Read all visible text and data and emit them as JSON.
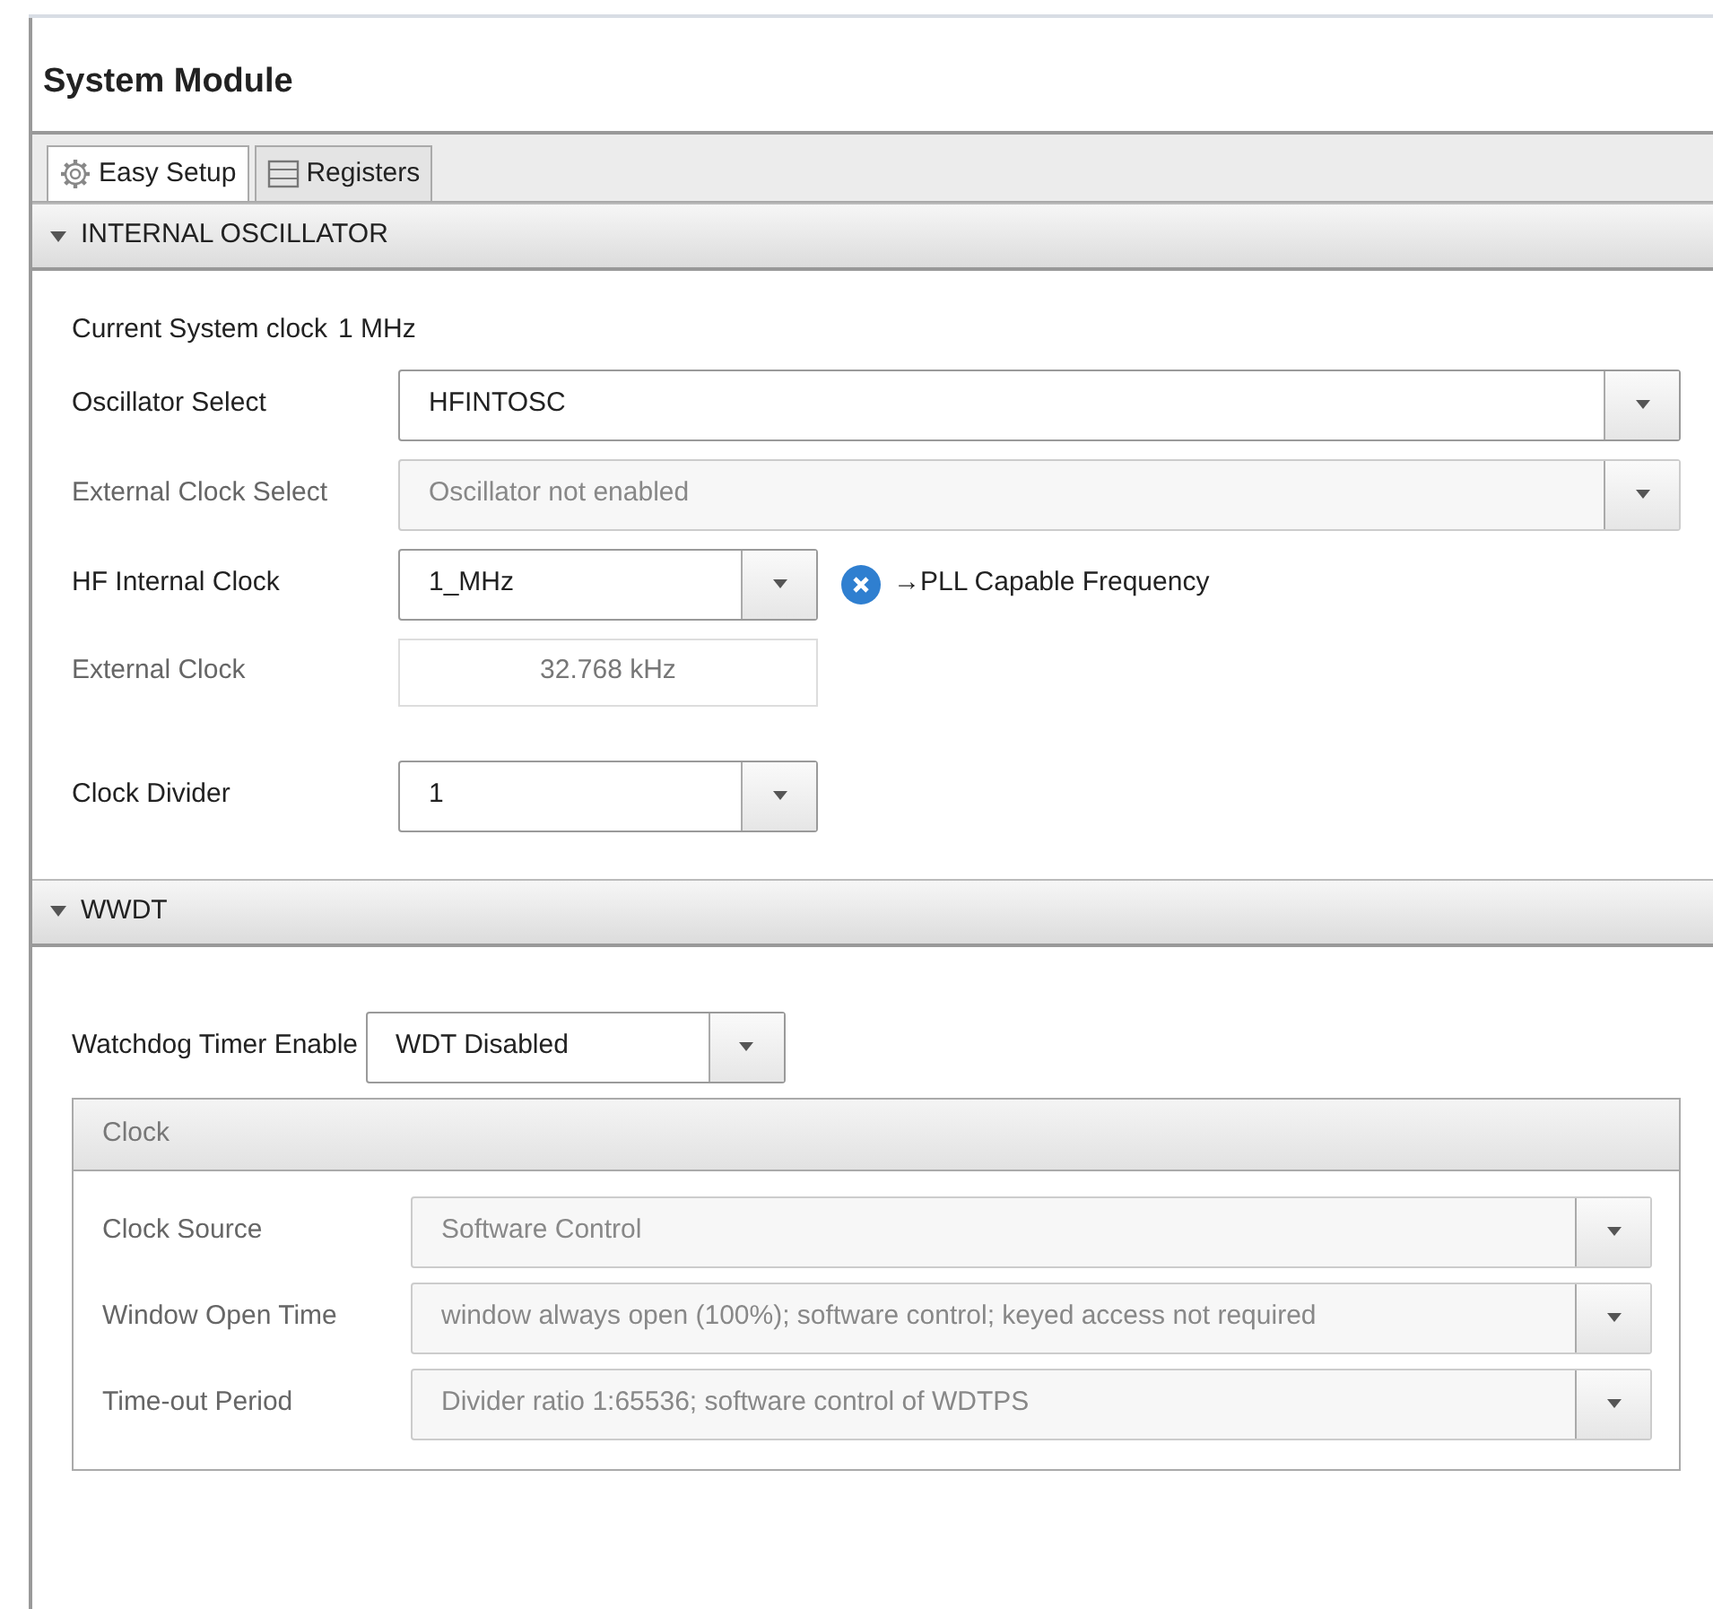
{
  "title": "System Module",
  "tabs": [
    {
      "label": "Easy Setup",
      "selected": true
    },
    {
      "label": "Registers",
      "selected": false
    }
  ],
  "sections": [
    {
      "title": "INTERNAL OSCILLATOR",
      "expanded": true,
      "blocks": [
        [
          {
            "kind": "info",
            "label": "Current System clock",
            "value": "1 MHz"
          },
          {
            "kind": "combo",
            "label": "Oscillator Select",
            "value": "HFINTOSC",
            "wide": true,
            "disabled": false
          },
          {
            "kind": "combo",
            "label": "External Clock Select",
            "value": "Oscillator not enabled",
            "wide": true,
            "disabled": true
          },
          {
            "kind": "combo",
            "label": "HF Internal Clock",
            "value": "1_MHz",
            "wide": false,
            "disabled": false,
            "note": "→PLL Capable Frequency"
          },
          {
            "kind": "text",
            "label": "External Clock",
            "value": "32.768 kHz",
            "disabled": true
          }
        ],
        [
          {
            "kind": "combo",
            "label": "Clock Divider",
            "value": "1",
            "wide": false,
            "disabled": false
          }
        ]
      ]
    },
    {
      "title": "WWDT",
      "expanded": true,
      "blocks": [
        [
          {
            "kind": "combo",
            "label": "Watchdog Timer Enable",
            "value": "WDT Disabled",
            "wide": false,
            "disabled": false
          }
        ]
      ],
      "group": {
        "title": "Clock",
        "rows": [
          {
            "kind": "combo",
            "label": "Clock Source",
            "value": "Software Control",
            "wide": true,
            "disabled": true
          },
          {
            "kind": "combo",
            "label": "Window Open Time",
            "value": "window always open (100%); software control; keyed access not required",
            "wide": true,
            "disabled": true
          },
          {
            "kind": "combo",
            "label": "Time-out Period",
            "value": "Divider ratio 1:65536; software control of WDTPS",
            "wide": true,
            "disabled": true
          }
        ]
      }
    }
  ]
}
